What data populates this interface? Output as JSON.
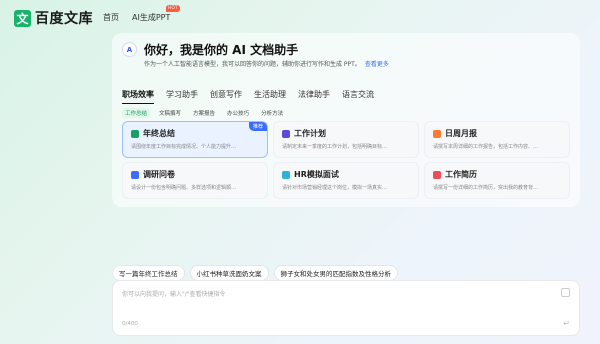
{
  "header": {
    "logo_mark": "文",
    "logo_text": "百度文库",
    "nav": [
      {
        "label": "首页"
      },
      {
        "label": "AI生成PPT"
      }
    ],
    "hot_badge": "HOT"
  },
  "assistant": {
    "icon_text": "A",
    "greeting": "你好，我是你的 AI 文档助手",
    "subtitle": "作为一个人工智能语言模型，我可以回答你的问题，辅助你进行写作和生成 PPT。",
    "more_link": "查看更多"
  },
  "categories": [
    {
      "label": "职场效率",
      "active": true
    },
    {
      "label": "学习助手",
      "active": false
    },
    {
      "label": "创意写作",
      "active": false
    },
    {
      "label": "生活助理",
      "active": false
    },
    {
      "label": "法律助手",
      "active": false
    },
    {
      "label": "语言交流",
      "active": false
    }
  ],
  "subcategories": [
    {
      "label": "工作总结",
      "active": true
    },
    {
      "label": "文稿撰写",
      "active": false
    },
    {
      "label": "方案报告",
      "active": false
    },
    {
      "label": "办公技巧",
      "active": false
    },
    {
      "label": "分析方法",
      "active": false
    }
  ],
  "tiles": [
    {
      "title": "年终总结",
      "desc": "请围绕年度工作目标完成情况、个人能力提升…",
      "icon_color": "#17a063",
      "icon": "document-icon",
      "badge": "推荐"
    },
    {
      "title": "工作计划",
      "desc": "请制定未来一季度的工作计划，包括明确目标…",
      "icon_color": "#5b4bd6",
      "icon": "plan-icon",
      "badge": ""
    },
    {
      "title": "日周月报",
      "desc": "请撰写本周详细的工作报告，包括工作内容、…",
      "icon_color": "#ff7a30",
      "icon": "report-icon",
      "badge": ""
    },
    {
      "title": "调研问卷",
      "desc": "请设计一份包含明确问题、多样选项和逻辑顺…",
      "icon_color": "#3b6cff",
      "icon": "survey-icon",
      "badge": ""
    },
    {
      "title": "HR模拟面试",
      "desc": "请针对市场营销经理这个岗位，模拟一场真实…",
      "icon_color": "#2bb3d9",
      "icon": "interview-icon",
      "badge": ""
    },
    {
      "title": "工作简历",
      "desc": "请撰写一份详细的工作简历，突出我的教育背…",
      "icon_color": "#f04b5a",
      "icon": "resume-icon",
      "badge": ""
    }
  ],
  "quick_prompts": [
    {
      "label": "写一篇年终工作总结"
    },
    {
      "label": "小红书种草洗面奶文案"
    },
    {
      "label": "狮子女和处女男的匹配指数及性格分析"
    }
  ],
  "input": {
    "placeholder": "你可以向我提问，输入\"/\"查看快捷指令",
    "counter": "0/400"
  }
}
